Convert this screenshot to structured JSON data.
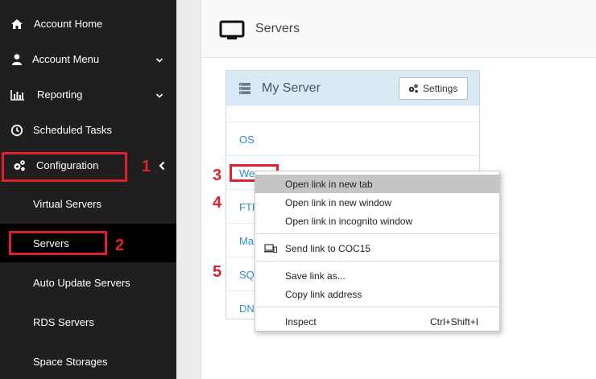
{
  "sidebar": {
    "items": [
      {
        "label": "Account Home",
        "icon": "home-icon"
      },
      {
        "label": "Account Menu",
        "icon": "user-icon"
      },
      {
        "label": "Reporting",
        "icon": "chart-icon"
      },
      {
        "label": "Scheduled Tasks",
        "icon": "clock-icon"
      },
      {
        "label": "Configuration",
        "icon": "gears-icon"
      }
    ],
    "subitems": [
      {
        "label": "Virtual Servers"
      },
      {
        "label": "Servers"
      },
      {
        "label": "Auto Update Servers"
      },
      {
        "label": "RDS Servers"
      },
      {
        "label": "Space Storages"
      }
    ]
  },
  "annotations": {
    "n1": "1",
    "n2": "2",
    "n3": "3",
    "n4": "4",
    "n5": "5"
  },
  "page": {
    "title": "Servers"
  },
  "panel": {
    "title": "My Server",
    "settings_label": "Settings",
    "rows": [
      "OS",
      "We",
      "FTP",
      "Ma",
      "SQL",
      "DN"
    ]
  },
  "context_menu": {
    "items": [
      {
        "label": "Open link in new tab"
      },
      {
        "label": "Open link in new window"
      },
      {
        "label": "Open link in incognito window"
      },
      {
        "label": "Send link to COC15"
      },
      {
        "label": "Save link as..."
      },
      {
        "label": "Copy link address"
      },
      {
        "label": "Inspect",
        "shortcut": "Ctrl+Shift+I"
      }
    ]
  },
  "colors": {
    "sidebar_bg": "#1f1f1f",
    "annotation_red": "#e0212b",
    "link_blue": "#2e8ec6",
    "panel_head_bg": "#daeaf4"
  }
}
